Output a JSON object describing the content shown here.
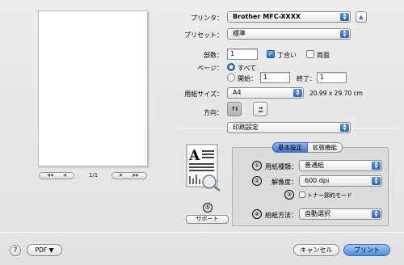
{
  "preview": {
    "first_label": "◀◀",
    "prev_label": "◀",
    "page_indicator": "1/1",
    "next_label": "▶",
    "last_label": "▶▶"
  },
  "printer": {
    "label": "プリンタ：",
    "value": "Brother MFC-XXXX"
  },
  "presets": {
    "label": "プリセット：",
    "value": "標準"
  },
  "copies": {
    "label": "部数：",
    "value": "1",
    "collated_label": "丁合い",
    "collated": true,
    "duplex_label": "両面",
    "duplex": false
  },
  "pages": {
    "label": "ページ：",
    "all_label": "すべて",
    "from_label": "開始：",
    "from_value": "1",
    "to_label": "終了：",
    "to_value": "1"
  },
  "paper_size": {
    "label": "用紙サイズ：",
    "value": "A4",
    "dimensions": "20.99 x 29.70 cm"
  },
  "orientation": {
    "label": "方向：",
    "portrait_glyph": "↑ⅰ",
    "landscape_glyph": "↑ⅰ"
  },
  "panel": {
    "value": "印刷設定"
  },
  "tabs": [
    {
      "label": "基本設定",
      "active": true
    },
    {
      "label": "拡張機能",
      "active": false
    }
  ],
  "settings": {
    "media_type": {
      "num": "①",
      "label": "用紙種類：",
      "value": "普通紙"
    },
    "resolution": {
      "num": "②",
      "label": "解像度：",
      "value": "600 dpi"
    },
    "toner_save": {
      "num": "③",
      "label": "トナー節約モード",
      "checked": false
    },
    "paper_source": {
      "num": "④",
      "label": "給紙方法：",
      "value": "自動選択"
    }
  },
  "support": {
    "num": "⑤",
    "label": "サポート"
  },
  "footer": {
    "help": "?",
    "pdf_label": "PDF ▼",
    "cancel_label": "キャンセル",
    "print_label": "プリント"
  },
  "thumb": {
    "letter": "A"
  },
  "colors": {
    "accent": "#3d77d0",
    "background": "#e8e8e8"
  }
}
